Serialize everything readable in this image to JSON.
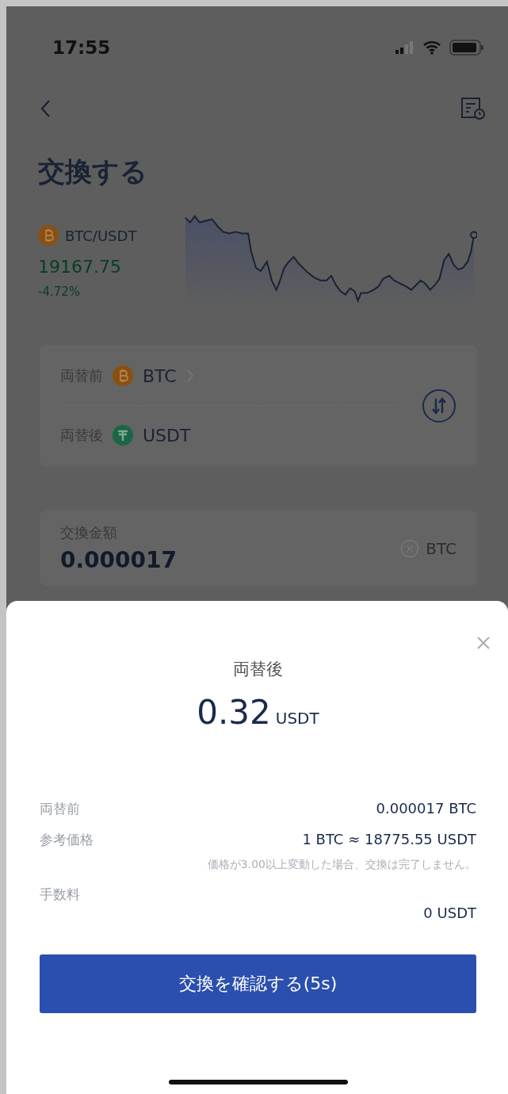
{
  "status_bar": {
    "time": "17:55"
  },
  "header": {
    "title": "交換する"
  },
  "ticker": {
    "pair": "BTC/USDT",
    "price": "19167.75",
    "change": "-4.72%"
  },
  "pair_card": {
    "rows": [
      {
        "label": "両替前",
        "coin": "BTC",
        "kind": "btc",
        "has_chevron": true
      },
      {
        "label": "両替後",
        "coin": "USDT",
        "kind": "usdt",
        "has_chevron": false
      }
    ]
  },
  "amount_card": {
    "label": "交換金額",
    "value": "0.000017",
    "unit": "BTC"
  },
  "confirm_sheet": {
    "title": "両替後",
    "amount": "0.32",
    "unit": "USDT",
    "details": [
      {
        "label": "両替前",
        "value": "0.000017 BTC"
      },
      {
        "label": "参考価格",
        "value": "1 BTC ≈ 18775.55 USDT",
        "note": "価格が3.00以上変動した場合、交換は完了しません。"
      },
      {
        "label": "手数料",
        "value": "0 USDT"
      }
    ],
    "button": "交換を確認する(5s)"
  }
}
